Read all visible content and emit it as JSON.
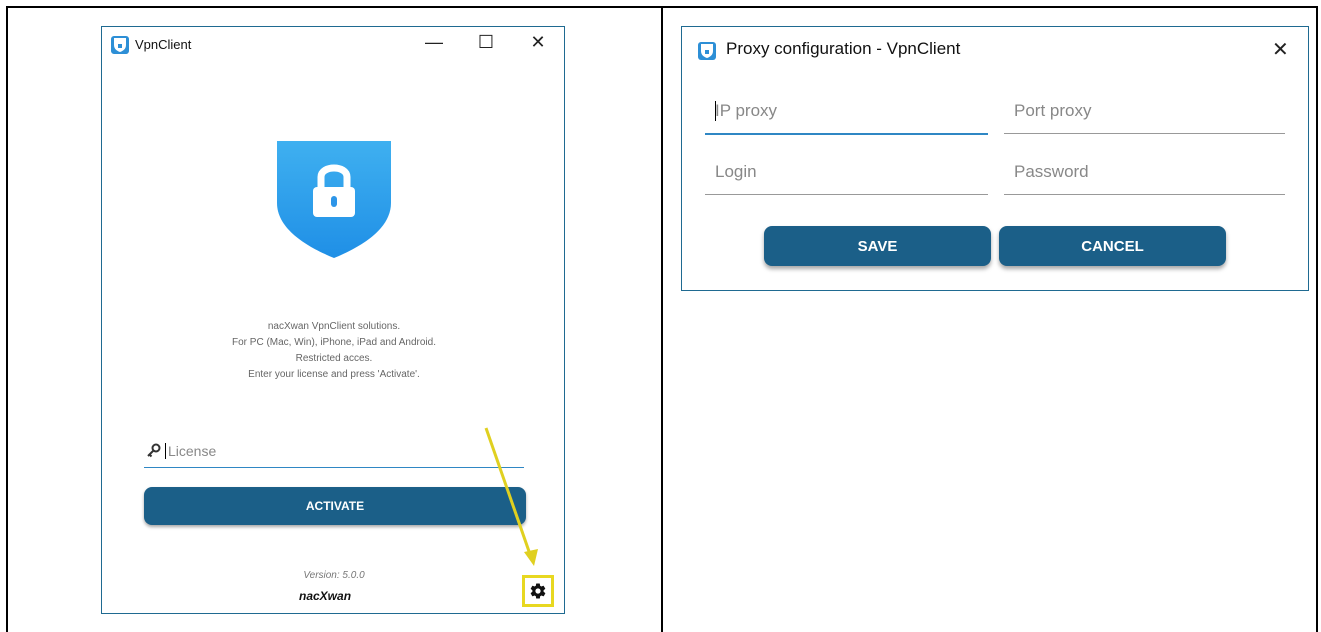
{
  "vpn_window": {
    "title": "VpnClient",
    "minimize_glyph": "—",
    "maximize_glyph": "☐",
    "close_glyph": "✕",
    "description_lines": [
      "nacXwan VpnClient solutions.",
      "For PC (Mac, Win), iPhone, iPad and Android.",
      "Restricted acces.",
      "Enter your license and press 'Activate'."
    ],
    "license_placeholder": "License",
    "activate_label": "ACTIVATE",
    "version": "Version: 5.0.0",
    "brand": "nacXwan"
  },
  "proxy_dialog": {
    "title": "Proxy configuration - VpnClient",
    "close_glyph": "✕",
    "fields": {
      "ip_proxy": "IP proxy",
      "port_proxy": "Port proxy",
      "login": "Login",
      "password": "Password"
    },
    "save_label": "SAVE",
    "cancel_label": "CANCEL"
  },
  "colors": {
    "accent_blue": "#2f87c4",
    "button_blue": "#1b5f88",
    "highlight_yellow": "#e8d820"
  },
  "icons": [
    "app-shield-icon",
    "lock-shield-icon",
    "key-icon",
    "gear-icon",
    "arrow-annotation"
  ]
}
